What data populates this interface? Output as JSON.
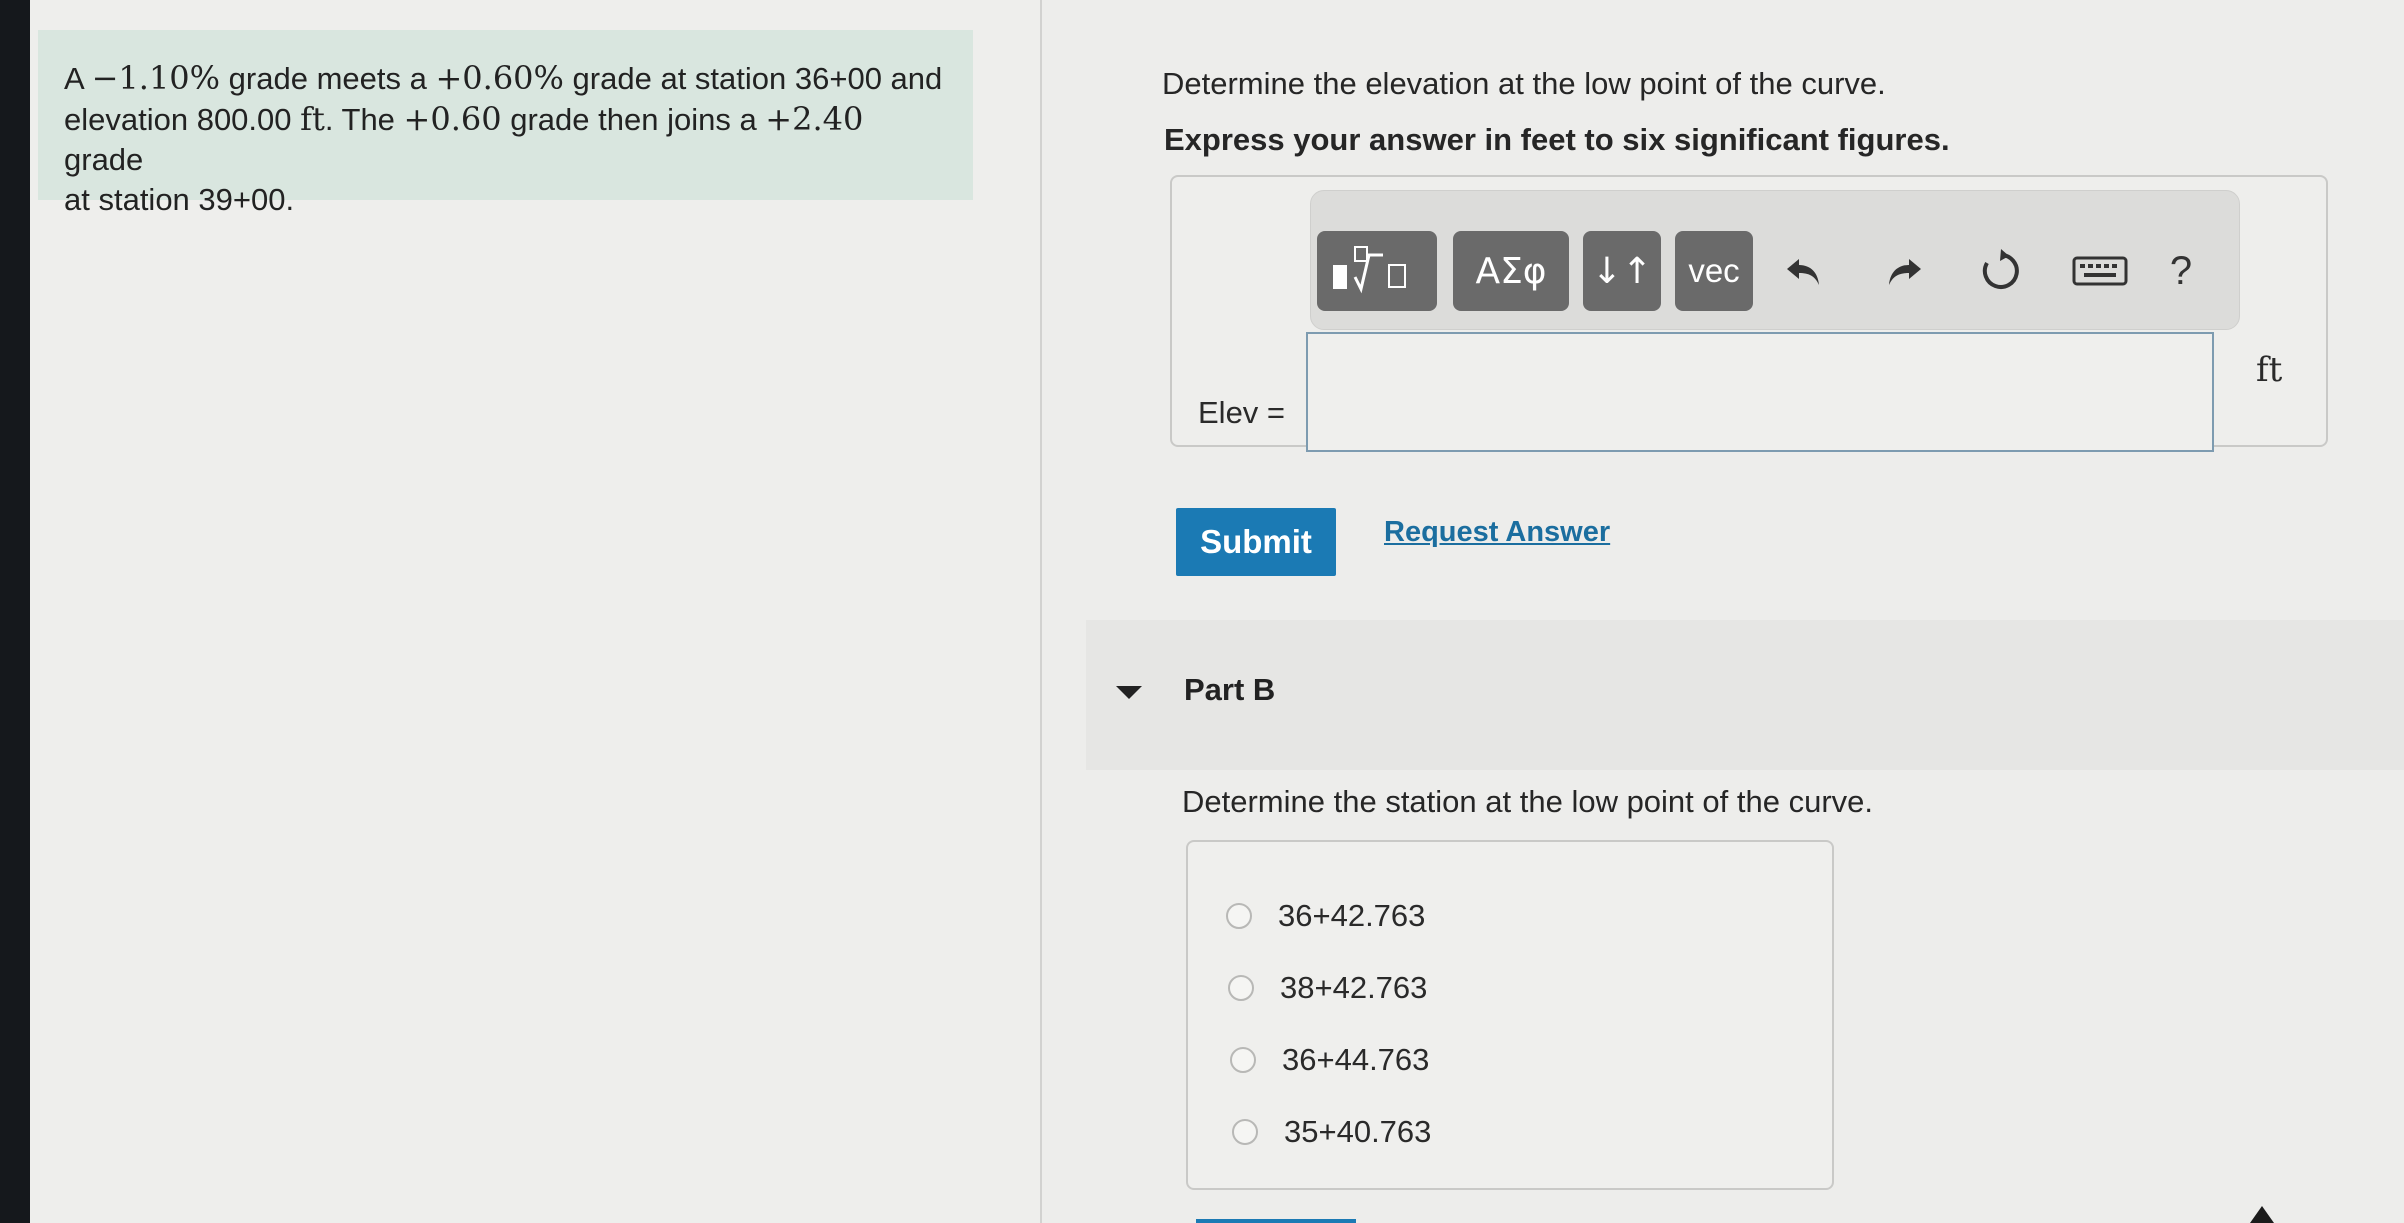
{
  "problem": {
    "pre1": "A ",
    "grade1": "−1.10%",
    "mid1": " grade meets a ",
    "grade2": "+0.60%",
    "mid2": " grade at station 36+00 and",
    "mid3": "elevation 800.00 ",
    "unit": "ft",
    "mid4": ". The ",
    "grade3": "+0.60",
    "mid5": " grade then joins a ",
    "grade4": "+2.40",
    "mid6": " grade",
    "end": "at station 39+00."
  },
  "part_a": {
    "prompt": "Determine the elevation at the low point of the curve.",
    "instruction": "Express your answer in feet to six significant figures.",
    "input_label": "Elev =",
    "input_value": "",
    "unit": "ft",
    "submit_label": "Submit",
    "request_label": "Request Answer"
  },
  "toolbar": {
    "template_icon": "fraction-radical-template-icon",
    "greek_label": "ΑΣφ",
    "arrows_label": "↓↑",
    "vec_label": "vec",
    "undo_icon": "undo-icon",
    "redo_icon": "redo-icon",
    "reset_icon": "reset-icon",
    "keyboard_icon": "keyboard-icon",
    "help_label": "?"
  },
  "part_b": {
    "title": "Part B",
    "prompt": "Determine the station at the low point of the curve.",
    "choices": [
      "36+42.763",
      "38+42.763",
      "36+44.763",
      "35+40.763"
    ]
  }
}
